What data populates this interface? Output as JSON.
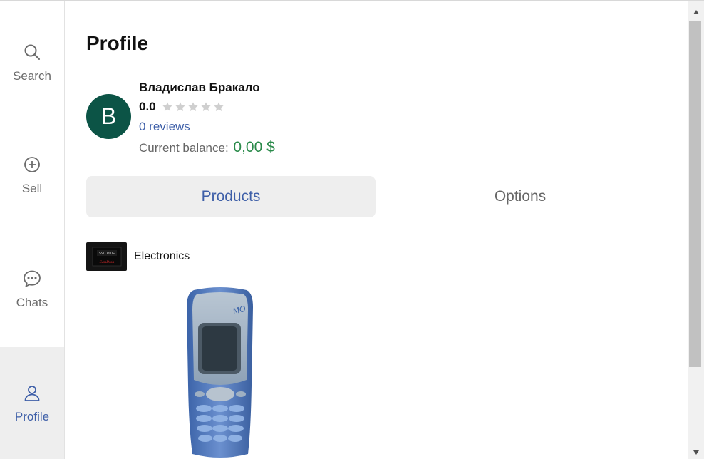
{
  "sidebar": {
    "items": [
      {
        "label": "Search",
        "icon": "search-icon",
        "active": false
      },
      {
        "label": "Sell",
        "icon": "plus-circle-icon",
        "active": false
      },
      {
        "label": "Chats",
        "icon": "chat-bubble-icon",
        "active": false
      },
      {
        "label": "Profile",
        "icon": "user-icon",
        "active": true
      }
    ]
  },
  "profile": {
    "title": "Profile",
    "avatar_letter": "B",
    "name": "Владислав Бракало",
    "rating": "0.0",
    "rating_stars": 0,
    "reviews": "0 reviews",
    "balance_label": "Current balance:",
    "balance_value": "0,00 $"
  },
  "tabs": [
    {
      "label": "Products",
      "active": true
    },
    {
      "label": "Options",
      "active": false
    }
  ],
  "category": {
    "label": "Electronics",
    "thumb_text_top": "SSD PLUS",
    "thumb_text_bottom": "SanDisk"
  },
  "colors": {
    "accent": "#3e5fa8",
    "avatar_bg": "#0c5446",
    "balance": "#2a8a4a",
    "active_bg": "#eeeeee"
  }
}
